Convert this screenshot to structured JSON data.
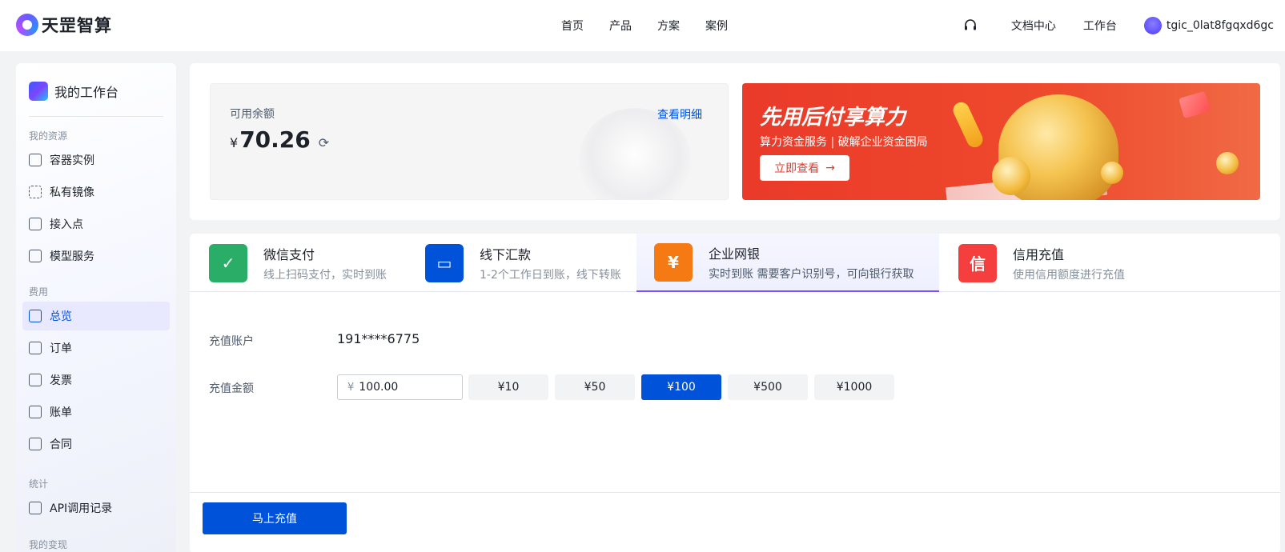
{
  "brand": {
    "name": "天罡智算"
  },
  "nav": {
    "items": [
      "首页",
      "产品",
      "方案",
      "案例"
    ]
  },
  "topright": {
    "docs": "文档中心",
    "workbench": "工作台",
    "username": "tgic_0lat8fgqxd6gc",
    "headset_icon": "headset-icon"
  },
  "sidebar": {
    "title": "我的工作台",
    "groups": {
      "resources": "我的资源",
      "billing": "费用",
      "stats": "统计",
      "monetize": "我的变现"
    },
    "items": [
      {
        "label": "容器实例",
        "icon": "server-icon"
      },
      {
        "label": "私有镜像",
        "icon": "image-icon"
      },
      {
        "label": "接入点",
        "icon": "endpoint-icon"
      },
      {
        "label": "模型服务",
        "icon": "model-icon"
      },
      {
        "label": "总览",
        "icon": "overview-icon",
        "active": true
      },
      {
        "label": "订单",
        "icon": "order-icon"
      },
      {
        "label": "发票",
        "icon": "invoice-icon"
      },
      {
        "label": "账单",
        "icon": "bill-icon"
      },
      {
        "label": "合同",
        "icon": "contract-icon"
      },
      {
        "label": "API调用记录",
        "icon": "api-icon"
      }
    ]
  },
  "balance": {
    "label": "可用余额",
    "currency": "¥",
    "value": "70.26",
    "detail_link": "查看明细"
  },
  "banner": {
    "title": "先用后付享算力",
    "subtitle": "算力资金服务 | 破解企业资金困局",
    "button": "立即查看"
  },
  "pay_tabs": [
    {
      "title": "微信支付",
      "desc": "线上扫码支付，实时到账",
      "color": "#2aae67",
      "glyph": "✓"
    },
    {
      "title": "线下汇款",
      "desc": "1-2个工作日到账，线下转账",
      "color": "#0052d9",
      "glyph": "▭"
    },
    {
      "title": "企业网银",
      "desc": "实时到账  需要客户识别号，可向银行获取",
      "color": "#f57a14",
      "glyph": "¥",
      "active": true
    },
    {
      "title": "信用充值",
      "desc": "使用信用额度进行充值",
      "color": "#f53f3f",
      "glyph": "信"
    }
  ],
  "form": {
    "account_label": "充值账户",
    "account_value": "191****6775",
    "amount_label": "充值金额",
    "amount_currency": "¥",
    "amount_value": "100.00",
    "presets": [
      "¥10",
      "¥50",
      "¥100",
      "¥500",
      "¥1000"
    ],
    "selected_preset": "¥100",
    "submit": "马上充值"
  }
}
